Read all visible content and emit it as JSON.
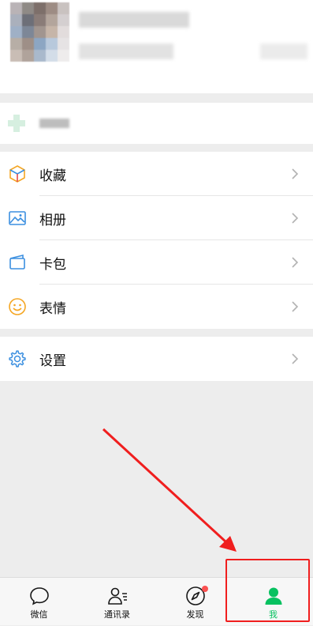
{
  "menu": {
    "items": [
      {
        "label": "收藏",
        "icon": "favorites-cube-icon"
      },
      {
        "label": "相册",
        "icon": "album-image-icon"
      },
      {
        "label": "卡包",
        "icon": "card-wallet-icon"
      },
      {
        "label": "表情",
        "icon": "emoji-smile-icon"
      }
    ],
    "settings": {
      "label": "设置",
      "icon": "settings-gear-icon"
    }
  },
  "tabbar": {
    "tabs": [
      {
        "label": "微信",
        "icon": "chat-bubble-icon"
      },
      {
        "label": "通讯录",
        "icon": "contacts-icon"
      },
      {
        "label": "发现",
        "icon": "compass-icon"
      },
      {
        "label": "我",
        "icon": "person-icon"
      }
    ],
    "active_index": 3
  },
  "colors": {
    "accent_green": "#07c160",
    "badge_red": "#fa5151",
    "annotation_red": "#f01e1e"
  }
}
